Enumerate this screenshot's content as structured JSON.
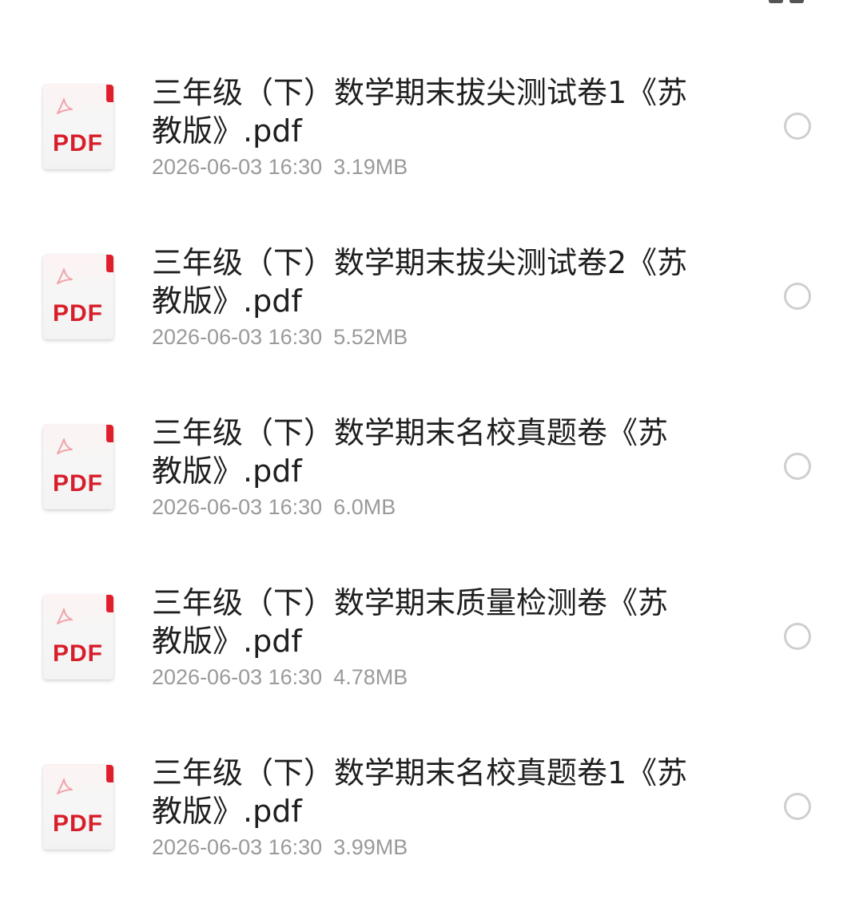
{
  "files": [
    {
      "icon": "pdf-file-icon",
      "type_label": "PDF",
      "name": "三年级（下）数学期末拔尖测试卷1《苏教版》.pdf",
      "date": "2026-06-03 16:30",
      "size": "3.19MB"
    },
    {
      "icon": "pdf-file-icon",
      "type_label": "PDF",
      "name": "三年级（下）数学期末拔尖测试卷2《苏教版》.pdf",
      "date": "2026-06-03 16:30",
      "size": "5.52MB"
    },
    {
      "icon": "pdf-file-icon",
      "type_label": "PDF",
      "name": "三年级（下）数学期末名校真题卷《苏教版》.pdf",
      "date": "2026-06-03 16:30",
      "size": "6.0MB"
    },
    {
      "icon": "pdf-file-icon",
      "type_label": "PDF",
      "name": "三年级（下）数学期末质量检测卷《苏教版》.pdf",
      "date": "2026-06-03 16:30",
      "size": "4.78MB"
    },
    {
      "icon": "pdf-file-icon",
      "type_label": "PDF",
      "name": "三年级（下）数学期末名校真题卷1《苏教版》.pdf",
      "date": "2026-06-03 16:30",
      "size": "3.99MB"
    }
  ],
  "colors": {
    "pdf_red": "#d81e2a",
    "title_text": "#1f1f1f",
    "meta_text": "#9a9a9a",
    "radio_border": "#cfcfcf"
  }
}
